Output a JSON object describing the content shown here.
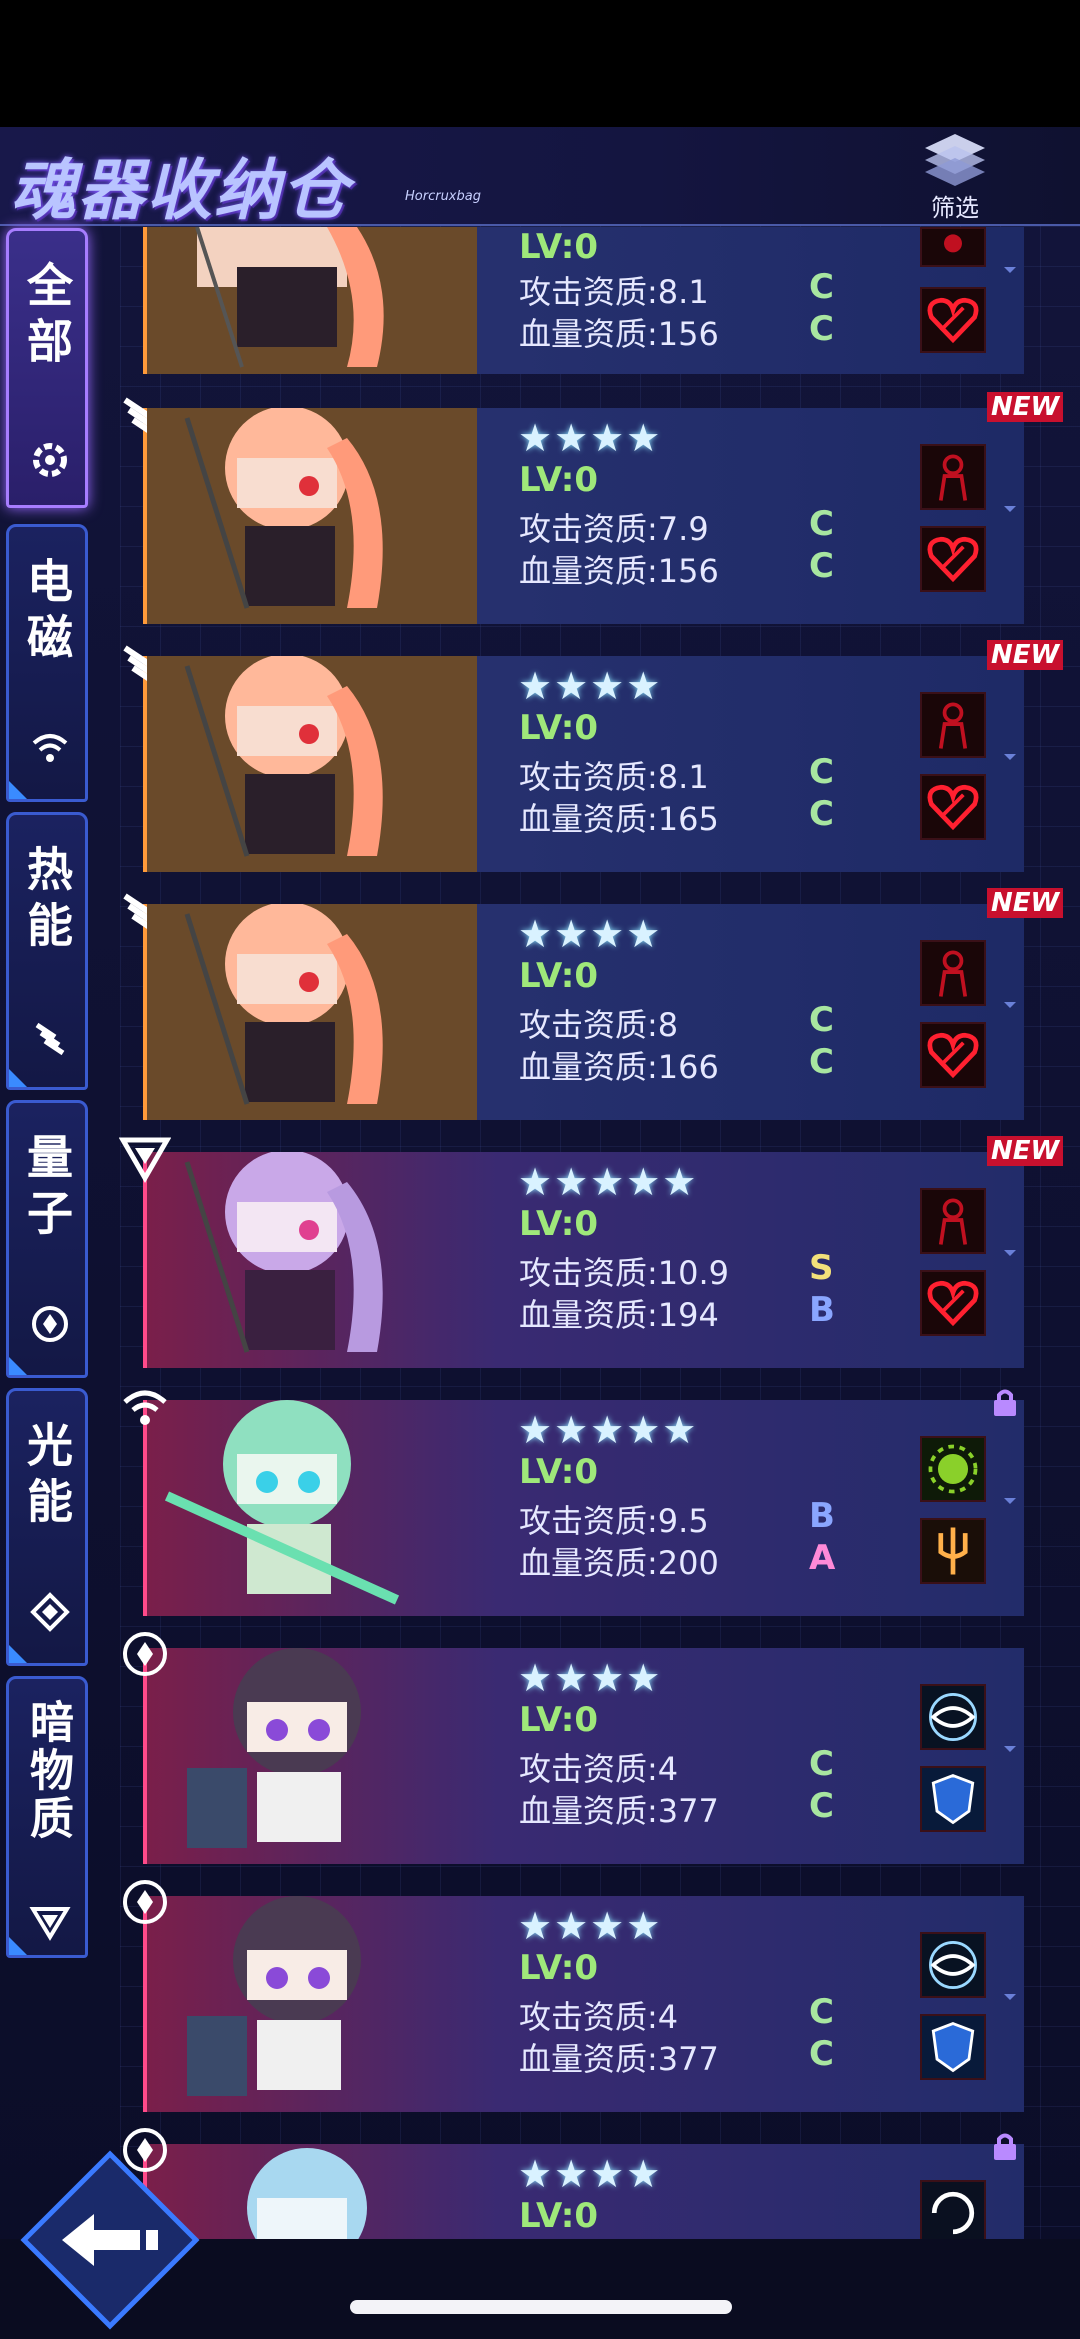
{
  "header": {
    "title": "魂器收纳仓",
    "subtitle": "Horcruxbag",
    "filter_label": "筛选"
  },
  "sidebar": {
    "tabs": [
      {
        "label": "全部",
        "icon": "gear-icon",
        "active": true
      },
      {
        "label": "电磁",
        "icon": "wifi-icon",
        "active": false
      },
      {
        "label": "热能",
        "icon": "flame-stripes-icon",
        "active": false
      },
      {
        "label": "量子",
        "icon": "quantum-ring-icon",
        "active": false
      },
      {
        "label": "光能",
        "icon": "diamond-icon",
        "active": false
      },
      {
        "label": "暗物质",
        "icon": "triangle-down-icon",
        "active": false
      }
    ]
  },
  "items": [
    {
      "stars": "",
      "lv": "LV:0",
      "atk": "攻击资质:8.1",
      "hp": "血量资质:156",
      "atk_grade": "C",
      "hp_grade": "C",
      "new": "",
      "locked": false,
      "element": "thermal"
    },
    {
      "stars": "★★★★",
      "lv": "LV:0",
      "atk": "攻击资质:7.9",
      "hp": "血量资质:156",
      "atk_grade": "C",
      "hp_grade": "C",
      "new": "NEW",
      "locked": false,
      "element": "thermal"
    },
    {
      "stars": "★★★★",
      "lv": "LV:0",
      "atk": "攻击资质:8.1",
      "hp": "血量资质:165",
      "atk_grade": "C",
      "hp_grade": "C",
      "new": "NEW",
      "locked": false,
      "element": "thermal"
    },
    {
      "stars": "★★★★",
      "lv": "LV:0",
      "atk": "攻击资质:8",
      "hp": "血量资质:166",
      "atk_grade": "C",
      "hp_grade": "C",
      "new": "NEW",
      "locked": false,
      "element": "thermal"
    },
    {
      "stars": "★★★★★",
      "lv": "LV:0",
      "atk": "攻击资质:10.9",
      "hp": "血量资质:194",
      "atk_grade": "S",
      "hp_grade": "B",
      "new": "NEW",
      "locked": false,
      "element": "dark"
    },
    {
      "stars": "★★★★★",
      "lv": "LV:0",
      "atk": "攻击资质:9.5",
      "hp": "血量资质:200",
      "atk_grade": "B",
      "hp_grade": "A",
      "new": "",
      "locked": true,
      "element": "electro"
    },
    {
      "stars": "★★★★",
      "lv": "LV:0",
      "atk": "攻击资质:4",
      "hp": "血量资质:377",
      "atk_grade": "C",
      "hp_grade": "C",
      "new": "",
      "locked": false,
      "element": "quantum"
    },
    {
      "stars": "★★★★",
      "lv": "LV:0",
      "atk": "攻击资质:4",
      "hp": "血量资质:377",
      "atk_grade": "C",
      "hp_grade": "C",
      "new": "",
      "locked": false,
      "element": "quantum"
    },
    {
      "stars": "★★★★",
      "lv": "LV:0",
      "atk": "",
      "hp": "",
      "atk_grade": "",
      "hp_grade": "",
      "new": "",
      "locked": true,
      "element": "quantum"
    }
  ],
  "colors": {
    "grade_C": "#a8e6a0",
    "grade_S": "#f2e07a",
    "grade_B": "#8aa6ff",
    "grade_A": "#ff8ad8",
    "accent_purple": "#a77dff",
    "accent_blue": "#3a5bd0"
  }
}
